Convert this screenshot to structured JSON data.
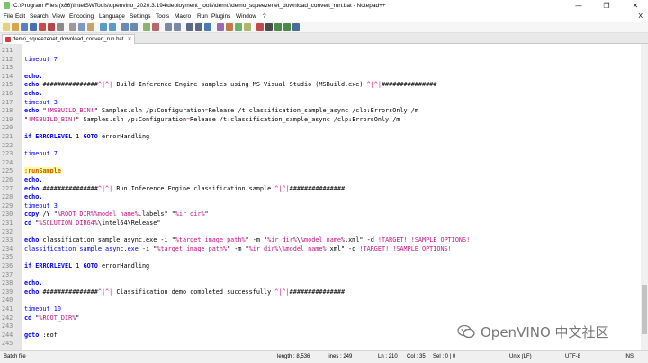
{
  "window": {
    "title": "C:\\Program Files (x86)\\IntelSWTools\\openvino_2020.3.194\\deployment_tools\\demo\\demo_squeezenet_download_convert_run.bat - Notepad++",
    "minimize": "—",
    "maximize": "❐",
    "close": "✕"
  },
  "menu": {
    "items": [
      "File",
      "Edit",
      "Search",
      "View",
      "Encoding",
      "Language",
      "Settings",
      "Tools",
      "Macro",
      "Run",
      "Plugins",
      "Window",
      "?"
    ],
    "close_x": "X"
  },
  "tab": {
    "label": "demo_squeezenet_download_convert_run.bat",
    "close": "✕"
  },
  "editor": {
    "lines": [
      {
        "n": "211",
        "segs": []
      },
      {
        "n": "212",
        "segs": [
          {
            "c": "blue",
            "t": "timeout 7"
          }
        ]
      },
      {
        "n": "213",
        "segs": []
      },
      {
        "n": "214",
        "segs": [
          {
            "c": "kw",
            "t": "echo."
          }
        ]
      },
      {
        "n": "215",
        "segs": [
          {
            "c": "kw",
            "t": "echo "
          },
          {
            "c": "plain",
            "t": "###############"
          },
          {
            "c": "var",
            "t": "^|^|"
          },
          {
            "c": "plain",
            "t": " Build Inference Engine samples using MS Visual Studio (MSBuild.exe) "
          },
          {
            "c": "var",
            "t": "^|^|"
          },
          {
            "c": "plain",
            "t": "###############"
          }
        ]
      },
      {
        "n": "216",
        "segs": [
          {
            "c": "kw",
            "t": "echo."
          }
        ]
      },
      {
        "n": "217",
        "segs": [
          {
            "c": "blue",
            "t": "timeout 3"
          }
        ]
      },
      {
        "n": "218",
        "segs": [
          {
            "c": "kw",
            "t": "echo "
          },
          {
            "c": "plain",
            "t": "\""
          },
          {
            "c": "var",
            "t": "!MSBUILD_BIN!"
          },
          {
            "c": "plain",
            "t": "\" Samples.sln /p:Configuration"
          },
          {
            "c": "var",
            "t": "="
          },
          {
            "c": "plain",
            "t": "Release /t:classification_sample_async /clp:ErrorsOnly /m"
          }
        ]
      },
      {
        "n": "219",
        "segs": [
          {
            "c": "plain",
            "t": "\""
          },
          {
            "c": "var",
            "t": "!MSBUILD_BIN!"
          },
          {
            "c": "plain",
            "t": "\" Samples.sln /p:Configuration"
          },
          {
            "c": "var",
            "t": "="
          },
          {
            "c": "plain",
            "t": "Release /t:classification_sample_async /clp:ErrorsOnly /m"
          }
        ]
      },
      {
        "n": "220",
        "segs": []
      },
      {
        "n": "221",
        "segs": [
          {
            "c": "kw",
            "t": "if ERRORLEVEL "
          },
          {
            "c": "plain",
            "t": "1 "
          },
          {
            "c": "kw",
            "t": "GOTO "
          },
          {
            "c": "plain",
            "t": "errorHandling"
          }
        ]
      },
      {
        "n": "222",
        "segs": []
      },
      {
        "n": "223",
        "segs": [
          {
            "c": "blue",
            "t": "timeout 7"
          }
        ]
      },
      {
        "n": "224",
        "segs": []
      },
      {
        "n": "225",
        "segs": [
          {
            "c": "lbl",
            "t": ":runSample"
          }
        ]
      },
      {
        "n": "226",
        "segs": [
          {
            "c": "kw",
            "t": "echo."
          }
        ]
      },
      {
        "n": "227",
        "segs": [
          {
            "c": "kw",
            "t": "echo "
          },
          {
            "c": "plain",
            "t": "###############"
          },
          {
            "c": "var",
            "t": "^|^|"
          },
          {
            "c": "plain",
            "t": " Run Inference Engine classification sample "
          },
          {
            "c": "var",
            "t": "^|^|"
          },
          {
            "c": "plain",
            "t": "###############"
          }
        ]
      },
      {
        "n": "228",
        "segs": [
          {
            "c": "kw",
            "t": "echo."
          }
        ]
      },
      {
        "n": "229",
        "segs": [
          {
            "c": "blue",
            "t": "timeout 3"
          }
        ]
      },
      {
        "n": "230",
        "segs": [
          {
            "c": "kw",
            "t": "copy "
          },
          {
            "c": "plain",
            "t": "/Y \""
          },
          {
            "c": "var",
            "t": "%ROOT_DIR%%model_name%"
          },
          {
            "c": "plain",
            "t": ".labels\" \""
          },
          {
            "c": "var",
            "t": "%ir_dir%"
          },
          {
            "c": "plain",
            "t": "\""
          }
        ]
      },
      {
        "n": "231",
        "segs": [
          {
            "c": "kw",
            "t": "cd "
          },
          {
            "c": "plain",
            "t": "\""
          },
          {
            "c": "var",
            "t": "%SOLUTION_DIR64%"
          },
          {
            "c": "plain",
            "t": "\\intel64\\Release\""
          }
        ]
      },
      {
        "n": "232",
        "segs": []
      },
      {
        "n": "233",
        "segs": [
          {
            "c": "kw",
            "t": "echo "
          },
          {
            "c": "plain",
            "t": "classification_sample_async.exe -i \""
          },
          {
            "c": "var",
            "t": "%target_image_path%"
          },
          {
            "c": "plain",
            "t": "\" -m \""
          },
          {
            "c": "var",
            "t": "%ir_dir%"
          },
          {
            "c": "plain",
            "t": "\\"
          },
          {
            "c": "var",
            "t": "%model_name%"
          },
          {
            "c": "plain",
            "t": ".xml\" -d "
          },
          {
            "c": "var",
            "t": "!TARGET! !SAMPLE_OPTIONS!"
          }
        ]
      },
      {
        "n": "234",
        "segs": [
          {
            "c": "blue",
            "t": "classification_sample_async.exe "
          },
          {
            "c": "plain",
            "t": "-i \""
          },
          {
            "c": "var",
            "t": "%target_image_path%"
          },
          {
            "c": "plain",
            "t": "\" -m \""
          },
          {
            "c": "var",
            "t": "%ir_dir%\\%model_name%"
          },
          {
            "c": "plain",
            "t": ".xml\" -d "
          },
          {
            "c": "var",
            "t": "!TARGET! !SAMPLE_OPTIONS!"
          }
        ]
      },
      {
        "n": "235",
        "segs": []
      },
      {
        "n": "236",
        "segs": [
          {
            "c": "kw",
            "t": "if ERRORLEVEL "
          },
          {
            "c": "plain",
            "t": "1 "
          },
          {
            "c": "kw",
            "t": "GOTO "
          },
          {
            "c": "plain",
            "t": "errorHandling"
          }
        ]
      },
      {
        "n": "237",
        "segs": []
      },
      {
        "n": "238",
        "segs": [
          {
            "c": "kw",
            "t": "echo."
          }
        ]
      },
      {
        "n": "239",
        "segs": [
          {
            "c": "kw",
            "t": "echo "
          },
          {
            "c": "plain",
            "t": "###############"
          },
          {
            "c": "var",
            "t": "^|^|"
          },
          {
            "c": "plain",
            "t": " Classification demo completed successfully "
          },
          {
            "c": "var",
            "t": "^|^|"
          },
          {
            "c": "plain",
            "t": "###############"
          }
        ]
      },
      {
        "n": "240",
        "segs": []
      },
      {
        "n": "241",
        "segs": [
          {
            "c": "blue",
            "t": "timeout 10"
          }
        ]
      },
      {
        "n": "242",
        "segs": [
          {
            "c": "kw",
            "t": "cd "
          },
          {
            "c": "plain",
            "t": "\""
          },
          {
            "c": "var",
            "t": "%ROOT_DIR%"
          },
          {
            "c": "plain",
            "t": "\""
          }
        ]
      },
      {
        "n": "243",
        "segs": []
      },
      {
        "n": "244",
        "segs": [
          {
            "c": "kw",
            "t": "goto "
          },
          {
            "c": "plain",
            "t": ":eof"
          }
        ]
      },
      {
        "n": "245",
        "segs": []
      }
    ]
  },
  "status": {
    "file_type": "Batch file",
    "length": "length : 8,536",
    "lines": "lines : 249",
    "ln": "Ln : 210",
    "col": "Col : 35",
    "sel": "Sel : 0 | 0",
    "eol": "Unix (LF)",
    "encoding": "UTF-8",
    "mode": "INS"
  },
  "watermark": {
    "text": "OpenVINO 中文社区",
    "icon": "wechat-logo-icon"
  },
  "colors": {
    "keyword": "#0000ff",
    "variable": "#c71585",
    "label": "#c95a00",
    "label_bg": "#fffa9e"
  }
}
